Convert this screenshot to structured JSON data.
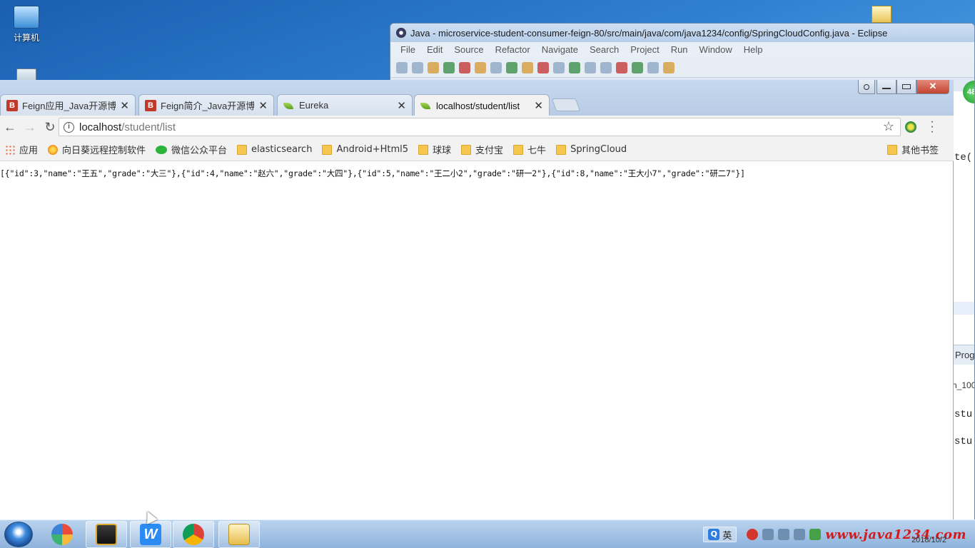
{
  "desktop": {
    "computer_label": "计算机"
  },
  "eclipse": {
    "title": "Java - microservice-student-consumer-feign-80/src/main/java/com/java1234/config/SpringCloudConfig.java - Eclipse",
    "menu": [
      "File",
      "Edit",
      "Source",
      "Refactor",
      "Navigate",
      "Search",
      "Project",
      "Run",
      "Window",
      "Help"
    ],
    "code_fragment_1": "te(",
    "progress_tab": "Prog",
    "n100": "n_100",
    "code_fragment_2": "stu",
    "code_fragment_3": "stu",
    "badge": "48"
  },
  "browser": {
    "tabs": [
      {
        "title": "Feign应用_Java开源博客",
        "favicon": "B",
        "active": false
      },
      {
        "title": "Feign简介_Java开源博客",
        "favicon": "B",
        "active": false
      },
      {
        "title": "Eureka",
        "favicon": "leaf",
        "active": false
      },
      {
        "title": "localhost/student/list",
        "favicon": "leaf",
        "active": true
      }
    ],
    "close_glyph": "✕",
    "url_host": "localhost",
    "url_path": "/student/list",
    "bookmarks": [
      {
        "label": "应用",
        "icon": "grid"
      },
      {
        "label": "向日葵远程控制软件",
        "icon": "sun"
      },
      {
        "label": "微信公众平台",
        "icon": "wechat"
      },
      {
        "label": "elasticsearch",
        "icon": "folder"
      },
      {
        "label": "Android+Html5",
        "icon": "folder"
      },
      {
        "label": "球球",
        "icon": "folder"
      },
      {
        "label": "支付宝",
        "icon": "folder"
      },
      {
        "label": "七牛",
        "icon": "folder"
      },
      {
        "label": "SpringCloud",
        "icon": "folder"
      }
    ],
    "other_bookmarks": "其他书签",
    "page_text": "[{\"id\":3,\"name\":\"王五\",\"grade\":\"大三\"},{\"id\":4,\"name\":\"赵六\",\"grade\":\"大四\"},{\"id\":5,\"name\":\"王二小2\",\"grade\":\"研一2\"},{\"id\":8,\"name\":\"王大小7\",\"grade\":\"研二7\"}]"
  },
  "taskbar": {
    "ime_label": "英",
    "watermark": "www.java1234.com",
    "clock_date": "2018/10/2"
  },
  "colors": {
    "accent": "#2f7fd0",
    "watermark": "#d31b1b"
  }
}
